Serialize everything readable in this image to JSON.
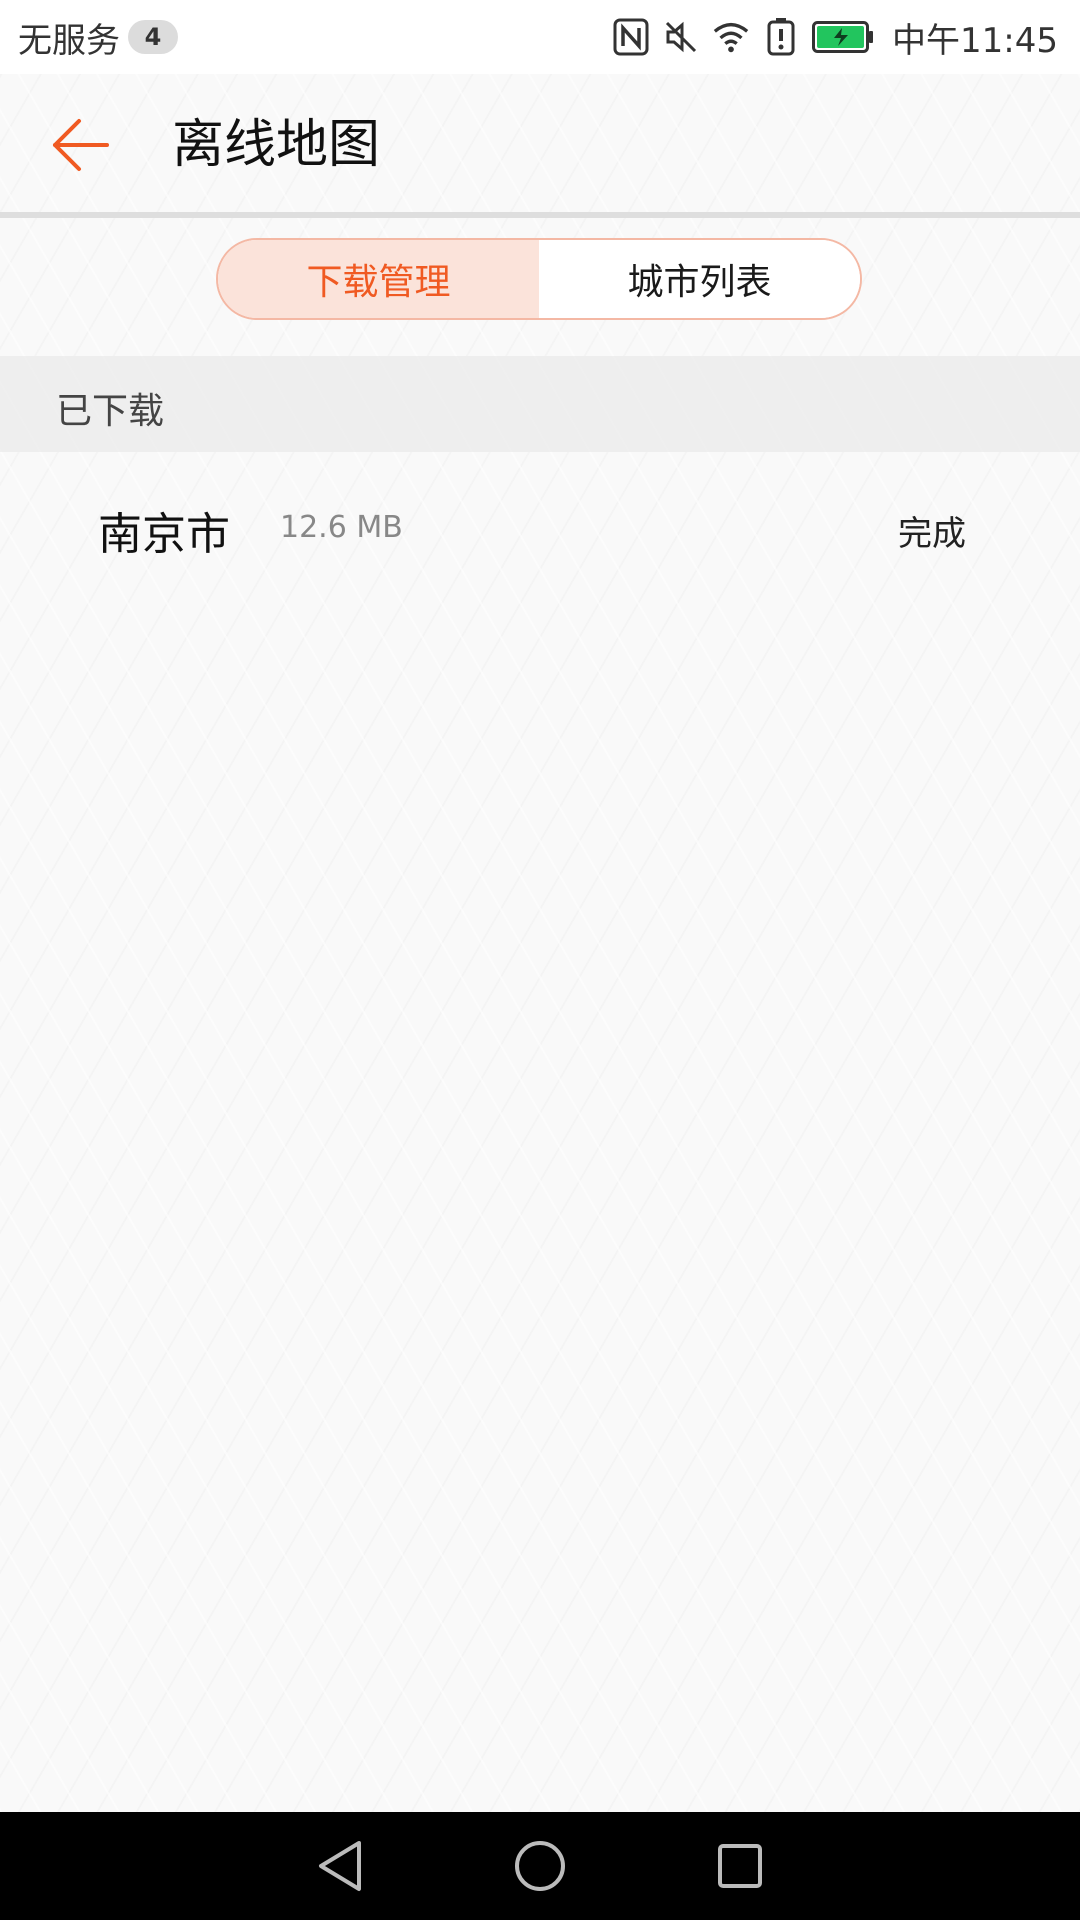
{
  "status_bar": {
    "carrier": "无服务",
    "sim_badge": "4",
    "time": "中午11:45",
    "icons": [
      "nfc-icon",
      "mute-icon",
      "wifi-icon",
      "alert-icon",
      "battery-charging-icon"
    ],
    "battery_color": "#22c55e"
  },
  "header": {
    "title": "离线地图",
    "back_icon": "back-arrow-icon",
    "accent_color": "#f05a22"
  },
  "tabs": [
    {
      "label": "下载管理",
      "active": true
    },
    {
      "label": "城市列表",
      "active": false
    }
  ],
  "downloaded_section": {
    "title": "已下载",
    "items": [
      {
        "city": "南京市",
        "size": "12.6 MB",
        "status": "完成"
      }
    ]
  },
  "nav_bar": {
    "buttons": [
      "back-triangle-icon",
      "home-circle-icon",
      "recents-square-icon"
    ]
  }
}
